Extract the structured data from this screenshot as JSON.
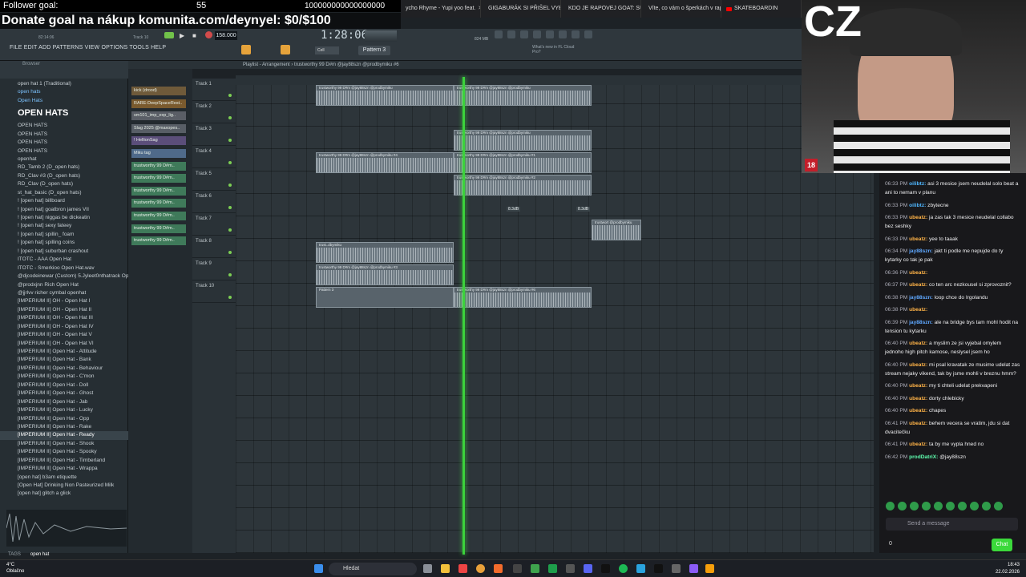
{
  "overlay": {
    "follower_label": "Follower goal:",
    "follower_count": "55",
    "follower_target": "100000000000000000",
    "follower_progress": 0.0,
    "donate": "Donate goal na nákup komunita.com/deynyel: $0/$100"
  },
  "browser_tabs": [
    "ycho Rhyme - Yupi yoo feat.",
    "GIGABURÁK SI PŘIŠEL VYBRAT",
    "KDO JE RAPOVEJ GOAT: SUPA",
    "Víte, co vám o šperkách v rap",
    "SKATEBOARDIN"
  ],
  "fl": {
    "menu": "FILE  EDIT  ADD  PATTERNS  VIEW  OPTIONS  TOOLS  HELP",
    "tempo": "158.000",
    "time": "1:28:06",
    "pattern": "Pattern 3",
    "snap": "Cell",
    "news": "What's new in FL Cloud Pro?",
    "track_label": "Track 10",
    "clock_small": "82:14:06",
    "memory": "824 MB",
    "playlist_title": "Playlist - Arrangement  ›  trustworthy 99 D#m @jay88szn @prodbymiku #6"
  },
  "browser": {
    "header": "Browser",
    "big_label": "OPEN HATS",
    "items": [
      {
        "label": "open hat 1 (Traditional)",
        "cls": ""
      },
      {
        "label": "open hats",
        "cls": "blue"
      },
      {
        "label": "Open Hats",
        "cls": "blue"
      },
      {
        "label": "",
        "cls": ""
      },
      {
        "label": "",
        "cls": ""
      },
      {
        "label": "OPEN HATS",
        "cls": ""
      },
      {
        "label": "OPEN HATS",
        "cls": ""
      },
      {
        "label": "OPEN HATS",
        "cls": ""
      },
      {
        "label": "OPEN HATS",
        "cls": ""
      },
      {
        "label": "openhat",
        "cls": ""
      },
      {
        "label": "RD_Tamb 2 (D_open hats)",
        "cls": ""
      },
      {
        "label": "RD_Clav #3 (D_open hats)",
        "cls": ""
      },
      {
        "label": "RD_Clav (D_open hats)",
        "cls": ""
      },
      {
        "label": "st_hat_basic (D_open hats)",
        "cls": ""
      },
      {
        "label": "! [open hat] billboard",
        "cls": ""
      },
      {
        "label": "! [open hat] goatbron james VII",
        "cls": ""
      },
      {
        "label": "! [open hat] niggas be dickeatin",
        "cls": ""
      },
      {
        "label": "! [open hat] sexy fateey",
        "cls": ""
      },
      {
        "label": "! [open hat] spillin_ foam",
        "cls": ""
      },
      {
        "label": "! [open hat] spilling coins",
        "cls": ""
      },
      {
        "label": "! [open hat] suburban crashout",
        "cls": ""
      },
      {
        "label": "ITOTC - AAA Open Hat",
        "cls": ""
      },
      {
        "label": "ITOTC - Smerkioo Open Hat.wav",
        "cls": ""
      },
      {
        "label": "@djcodeinewar (Custom) 5.Jyleet0nthatrack OpenHat",
        "cls": ""
      },
      {
        "label": "@prodxjnn Rich Open Hat",
        "cls": ""
      },
      {
        "label": "@jjrlvv richer cymbal openhat",
        "cls": ""
      },
      {
        "label": "[IMPERIUM II] OH - Open Hat I",
        "cls": ""
      },
      {
        "label": "[IMPERIUM II] OH - Open Hat II",
        "cls": ""
      },
      {
        "label": "[IMPERIUM II] OH - Open Hat III",
        "cls": ""
      },
      {
        "label": "[IMPERIUM II] OH - Open Hat IV",
        "cls": ""
      },
      {
        "label": "[IMPERIUM II] OH - Open Hat V",
        "cls": ""
      },
      {
        "label": "[IMPERIUM II] OH - Open Hat VI",
        "cls": ""
      },
      {
        "label": "[IMPERIUM II] Open Hat - Attitude",
        "cls": ""
      },
      {
        "label": "[IMPERIUM II] Open Hat - Bank",
        "cls": ""
      },
      {
        "label": "[IMPERIUM II] Open Hat - Behaviour",
        "cls": ""
      },
      {
        "label": "[IMPERIUM II] Open Hat - C'mon",
        "cls": ""
      },
      {
        "label": "[IMPERIUM II] Open Hat - Doll",
        "cls": ""
      },
      {
        "label": "[IMPERIUM II] Open Hat - Ghost",
        "cls": ""
      },
      {
        "label": "[IMPERIUM II] Open Hat - Jab",
        "cls": ""
      },
      {
        "label": "[IMPERIUM II] Open Hat - Lucky",
        "cls": ""
      },
      {
        "label": "[IMPERIUM II] Open Hat - Opp",
        "cls": ""
      },
      {
        "label": "[IMPERIUM II] Open Hat - Rake",
        "cls": ""
      },
      {
        "label": "[IMPERIUM II] Open Hat - Ready",
        "cls": "sel"
      },
      {
        "label": "[IMPERIUM II] Open Hat - Shook",
        "cls": ""
      },
      {
        "label": "[IMPERIUM II] Open Hat - Spooky",
        "cls": ""
      },
      {
        "label": "[IMPERIUM II] Open Hat - Timberland",
        "cls": ""
      },
      {
        "label": "[IMPERIUM II] Open Hat - Wrappa",
        "cls": ""
      },
      {
        "label": "[open hat] b3am etiquette",
        "cls": ""
      },
      {
        "label": "[Open Hat] Drinking Non Pasteurized Milk",
        "cls": ""
      },
      {
        "label": "[open hat] glitch a glick",
        "cls": ""
      }
    ],
    "tags_label": "TAGS",
    "tags_value": "open hat"
  },
  "channels": [
    "kick (drood)",
    "RARE-DeepSpaceRest..",
    "sm101_imp_exp_lig..",
    "Slag 2025 @maxopes..",
    "! HellionSag",
    "Miku tag",
    "trustworthy 99 D#m..",
    "trustworthy 99 D#m..",
    "trustworthy 99 D#m..",
    "trustworthy 99 D#m..",
    "trustworthy 99 D#m..",
    "trustworthy 99 D#m..",
    "trustworthy 99 D#m.."
  ],
  "tracks": [
    "Track 1",
    "Track 2",
    "Track 3",
    "Track 4",
    "Track 5",
    "Track 6",
    "Track 7",
    "Track 8",
    "Track 9",
    "Track 10"
  ],
  "clips": {
    "c1": "trustworthy 99 D#m @jay88szn @prodbymiku",
    "c2": "trustworthy 99 D#m @jay88szn @prodbymiku",
    "c3": "trustworthy 99 D#m @jay88szn @prodbymiku #4",
    "c4": "trustworthy 99 D#m @jay88szn @prodbymiku #1",
    "c5": "trustworthy 99 D#m @jay88szn @prodbymiku #2",
    "c6": "trustwort @prodbymiku",
    "c7": "trust..dbymiku",
    "c8": "trustworthy 99 D#m @jay88szn @prodbymiku #3",
    "c9": "Pattern 3",
    "c10": "trustworthy 99 D#m @jay88szn @prodbymiku #6",
    "vol1": "8.3dB",
    "vol2": "8.3dB"
  },
  "chat": {
    "messages": [
      {
        "t": "06:33 PM",
        "u": "oilibtz:",
        "c": "#4fb7ff",
        "m": "asi 3 mesice jsem neudelal solo beat a ani to nemam v planu"
      },
      {
        "t": "06:33 PM",
        "u": "oilibtz:",
        "c": "#4fb7ff",
        "m": "zbytecne"
      },
      {
        "t": "06:33 PM",
        "u": "ubeatz:",
        "c": "#ffb347",
        "m": "ja zas tak 3 mesice neudelal collabo bez seshky"
      },
      {
        "t": "06:33 PM",
        "u": "ubeatz:",
        "c": "#ffb347",
        "m": "yee to taaak"
      },
      {
        "t": "06:34 PM",
        "u": "jay88szn:",
        "c": "#5fa8ff",
        "m": "jakt ti podle me nepujde do ty kytarky co tak je pak"
      },
      {
        "t": "06:36 PM",
        "u": "ubeatz:",
        "c": "#ffb347",
        "m": ""
      },
      {
        "t": "06:37 PM",
        "u": "ubeatz:",
        "c": "#ffb347",
        "m": "co ten arc nezkousel si zprovoznit?"
      },
      {
        "t": "06:38 PM",
        "u": "jay88szn:",
        "c": "#5fa8ff",
        "m": "loop chce do Irgolandu"
      },
      {
        "t": "06:38 PM",
        "u": "ubeatz:",
        "c": "#ffb347",
        "m": ""
      },
      {
        "t": "06:39 PM",
        "u": "jay88szn:",
        "c": "#5fa8ff",
        "m": "ale na bridge bys tam mohl hodit na tension tu kytarku"
      },
      {
        "t": "06:40 PM",
        "u": "ubeatz:",
        "c": "#ffb347",
        "m": "a myslim ze jsi vyjebal omylem jednoho high pitch kamose, neslysel jsem ho"
      },
      {
        "t": "06:40 PM",
        "u": "ubeatz:",
        "c": "#ffb347",
        "m": "mi psal kravatak ze musime udelat zas stream nejaky vikend, tak by jsme mohli v breznu hmm?"
      },
      {
        "t": "06:40 PM",
        "u": "ubeatz:",
        "c": "#ffb347",
        "m": "my ti chteli udelat prekvapeni"
      },
      {
        "t": "06:40 PM",
        "u": "ubeatz:",
        "c": "#ffb347",
        "m": "dorty chlebicky"
      },
      {
        "t": "06:40 PM",
        "u": "ubeatz:",
        "c": "#ffb347",
        "m": "chapes"
      },
      {
        "t": "06:41 PM",
        "u": "ubeatz:",
        "c": "#ffb347",
        "m": "behem vecera se vratim, jdu si dat dvacitečku"
      },
      {
        "t": "06:41 PM",
        "u": "ubeatz:",
        "c": "#ffb347",
        "m": "ta by me vypla hned no"
      },
      {
        "t": "06:42 PM",
        "u": "prodDatriX:",
        "c": "#5fffb0",
        "m": "@jay88szn"
      }
    ],
    "input_placeholder": "Send a message",
    "send_label": "Chat",
    "points": "0"
  },
  "webcam": {
    "overlay_text": "CZ",
    "badge": "18"
  },
  "taskbar": {
    "search": "Hledat",
    "weather_temp": "4°C",
    "weather_desc": "Oblačno",
    "time": "18:43",
    "date": "22.02.2026"
  },
  "colors": {
    "accent": "#3cd23c",
    "chat_send": "#3bd93b",
    "follower_fill": "#41ff41"
  }
}
